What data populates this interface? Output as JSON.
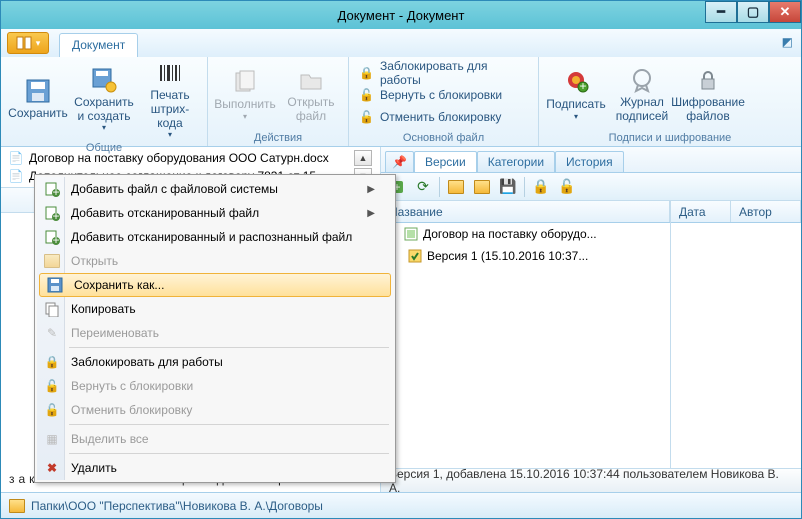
{
  "window": {
    "title": "Документ - Документ"
  },
  "tabs": {
    "document": "Документ"
  },
  "ribbon": {
    "save": "Сохранить",
    "save_create": "Сохранить\nи создать",
    "barcode": "Печать\nштрих-кода",
    "group_common": "Общие",
    "execute": "Выполнить",
    "open_file": "Открыть\nфайл",
    "group_actions": "Действия",
    "lock": "Заблокировать для работы",
    "unlock_return": "Вернуть с блокировки",
    "unlock_cancel": "Отменить блокировку",
    "group_mainfile": "Основной файл",
    "sign": "Подписать",
    "sign_log": "Журнал\nподписей",
    "encrypt": "Шифрование\nфайлов",
    "group_sign": "Подписи и шифрование"
  },
  "files": {
    "f1": "Договор на поставку оборудования ООО Сатурн.docx",
    "f2": "Дополнительное соглашение к договору 7831 от 15.10.2..."
  },
  "preview": {
    "snippet": "заключили   настоящий   договор   о"
  },
  "right_tabs": {
    "versions": "Версии",
    "categories": "Категории",
    "history": "История"
  },
  "tree": {
    "col_name": "Название",
    "col_date": "Дата",
    "col_author": "Автор",
    "node1": "Договор на поставку оборудо...",
    "node2": "Версия 1 (15.10.2016 10:37..."
  },
  "info_bar": "Версия 1, добавлена 15.10.2016 10:37:44 пользователем Новикова В. А.",
  "status_path": "Папки\\ООО \"Перспектива\"\\Новикова В. А.\\Договоры",
  "ctx": {
    "add_fs": "Добавить файл с файловой системы",
    "add_scan": "Добавить отсканированный файл",
    "add_scan_ocr": "Добавить отсканированный и распознанный файл",
    "open": "Открыть",
    "save_as": "Сохранить как...",
    "copy": "Копировать",
    "rename": "Переименовать",
    "lock": "Заблокировать для работы",
    "return_lock": "Вернуть с блокировки",
    "cancel_lock": "Отменить блокировку",
    "select_all": "Выделить все",
    "delete": "Удалить"
  }
}
